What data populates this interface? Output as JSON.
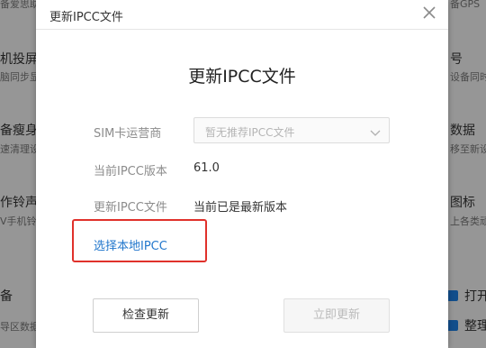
{
  "background": {
    "left_fragments": [
      {
        "text": "备爱思助",
        "small": true
      },
      {
        "text": "机投屏",
        "small": false
      },
      {
        "text": "脑同步显",
        "small": true
      },
      {
        "text": "备瘦身",
        "small": false
      },
      {
        "text": "速清理设",
        "small": true
      },
      {
        "text": "作铃声",
        "small": false
      },
      {
        "text": "V手机铃",
        "small": true
      },
      {
        "text": "备",
        "small": false
      },
      {
        "text": "导区数据",
        "small": true
      }
    ],
    "right_fragments": [
      {
        "text": "备GPS",
        "small": true
      },
      {
        "text": "号",
        "small": false
      },
      {
        "text": "设备同时",
        "small": true
      },
      {
        "text": "数据",
        "small": false
      },
      {
        "text": "移至新设",
        "small": true
      },
      {
        "text": "图标",
        "small": false
      },
      {
        "text": "上各类顽",
        "small": true
      },
      {
        "text": "打开",
        "small": false
      },
      {
        "text": "整理",
        "small": false
      }
    ]
  },
  "dialog": {
    "window_title": "更新IPCC文件",
    "heading": "更新IPCC文件",
    "fields": {
      "carrier_label": "SIM卡运营商",
      "carrier_placeholder": "暂无推荐IPCC文件",
      "current_version_label": "当前IPCC版本",
      "current_version_value": "61.0",
      "update_file_label": "更新IPCC文件",
      "update_file_value": "当前已是最新版本"
    },
    "local_link": "选择本地IPCC",
    "buttons": {
      "check_update": "检查更新",
      "update_now": "立即更新"
    }
  },
  "icons": {
    "close": "close-icon",
    "dropdown": "chevron-down-icon"
  },
  "colors": {
    "link": "#2277cc",
    "highlight_box": "#e0312b",
    "disabled_text": "#bbbbbb"
  }
}
